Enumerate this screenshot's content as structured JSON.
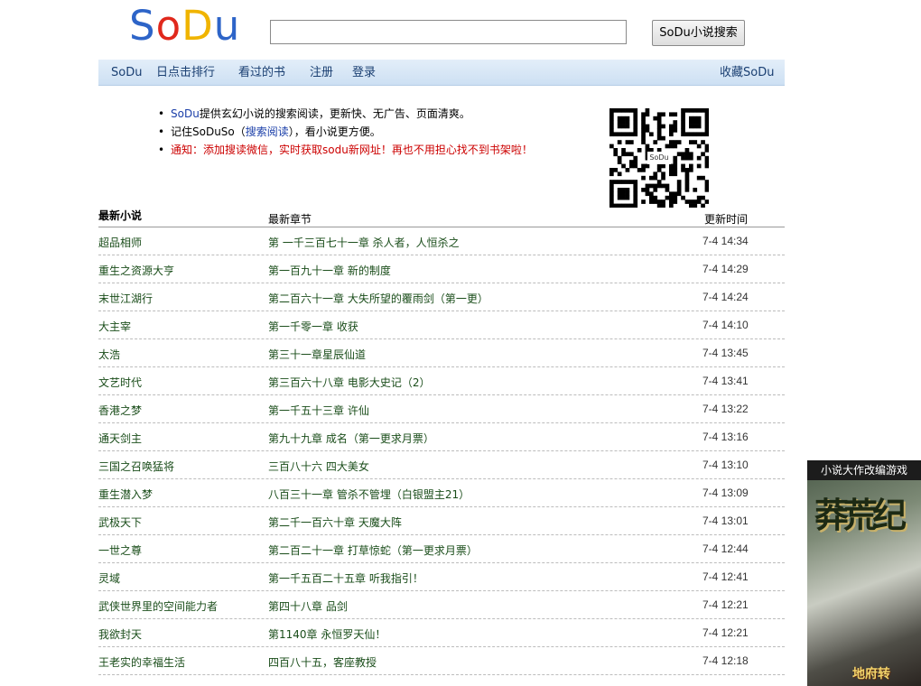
{
  "header": {
    "logo_letters": [
      "S",
      "o",
      "D",
      "u"
    ],
    "logo_colors": [
      "#2d64c8",
      "#e0281c",
      "#f0b400",
      "#2d64c8"
    ],
    "search_value": "",
    "search_button": "SoDu小说搜索"
  },
  "nav": {
    "items": [
      "SoDu",
      "日点击排行",
      "看过的书",
      "注册",
      "登录"
    ],
    "favorite": "收藏SoDu"
  },
  "notice": {
    "line1_brand": "SoDu",
    "line1_text": "提供玄幻小说的搜索阅读，更新快、无广告、页面清爽。",
    "line2_pre": "记住SoDuSo（",
    "line2_link": "搜索阅读",
    "line2_post": "），看小说更方便。",
    "line3": "通知：添加搜读微信，实时获取sodu新网址！再也不用担心找不到书架啦！",
    "qr_label": "SoDu"
  },
  "table": {
    "headers": {
      "name": "最新小说",
      "chapter": "最新章节",
      "time": "更新时间"
    },
    "rows": [
      {
        "name": "超品相师",
        "chapter": "第 一千三百七十一章 杀人者，人恒杀之",
        "time": "7-4 14:34"
      },
      {
        "name": "重生之资源大亨",
        "chapter": "第一百九十一章 新的制度",
        "time": "7-4 14:29"
      },
      {
        "name": "末世江湖行",
        "chapter": "第二百六十一章 大失所望的覆雨剑（第一更）",
        "time": "7-4 14:24"
      },
      {
        "name": "大主宰",
        "chapter": "第一千零一章 收获",
        "time": "7-4 14:10"
      },
      {
        "name": "太浩",
        "chapter": "第三十一章星辰仙道",
        "time": "7-4 13:45"
      },
      {
        "name": "文艺时代",
        "chapter": "第三百六十八章 电影大史记（2）",
        "time": "7-4 13:41"
      },
      {
        "name": "香港之梦",
        "chapter": "第一千五十三章 许仙",
        "time": "7-4 13:22"
      },
      {
        "name": "通天剑主",
        "chapter": "第九十九章 成名（第一更求月票）",
        "time": "7-4 13:16"
      },
      {
        "name": "三国之召唤猛将",
        "chapter": "三百八十六 四大美女",
        "time": "7-4 13:10"
      },
      {
        "name": "重生潜入梦",
        "chapter": "八百三十一章 管杀不管埋（白银盟主21）",
        "time": "7-4 13:09"
      },
      {
        "name": "武极天下",
        "chapter": "第二千一百六十章 天魔大阵",
        "time": "7-4 13:01"
      },
      {
        "name": "一世之尊",
        "chapter": "第二百二十一章 打草惊蛇（第一更求月票）",
        "time": "7-4 12:44"
      },
      {
        "name": "灵域",
        "chapter": "第一千五百二十五章 听我指引！",
        "time": "7-4 12:41"
      },
      {
        "name": "武侠世界里的空间能力者",
        "chapter": "第四十八章 品剑",
        "time": "7-4 12:21"
      },
      {
        "name": "我欲封天",
        "chapter": "第1140章 永恒罗天仙！",
        "time": "7-4 12:21"
      },
      {
        "name": "王老实的幸福生活",
        "chapter": "四百八十五，客座教授",
        "time": "7-4 12:18"
      }
    ]
  },
  "ad": {
    "title": "小说大作改编游戏",
    "art_text": "莽荒纪",
    "footer": "地府转"
  }
}
